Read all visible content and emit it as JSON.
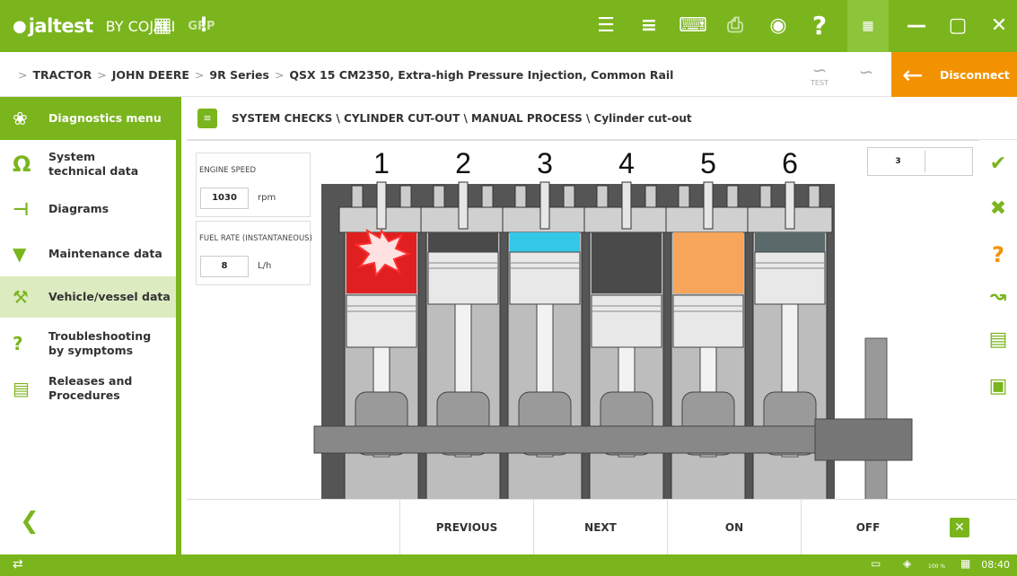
{
  "app": {
    "logo": "jaltest",
    "logo_sub": "BY COJALI",
    "mode": "GRP"
  },
  "breadcrumb": [
    "TRACTOR",
    "JOHN DEERE",
    "9R Series",
    "QSX 15 CM2350, Extra-high Pressure Injection, Common Rail"
  ],
  "breadcrumb_sep": ">",
  "test_label": "TEST",
  "disconnect_label": "Disconnect",
  "sidebar": {
    "items": [
      {
        "label": "Diagnostics menu",
        "icon": "stethoscope-icon"
      },
      {
        "label": "System technical data",
        "icon": "omega-icon"
      },
      {
        "label": "Diagrams",
        "icon": "diagram-icon"
      },
      {
        "label": "Maintenance data",
        "icon": "oil-can-icon"
      },
      {
        "label": "Vehicle/vessel data",
        "icon": "wrench-icon"
      },
      {
        "label": "Troubleshooting by symptoms",
        "icon": "tools-icon"
      },
      {
        "label": "Releases and Procedures",
        "icon": "document-icon"
      }
    ]
  },
  "header": {
    "path": "SYSTEM CHECKS \\ CYLINDER CUT-OUT \\ MANUAL PROCESS \\ Cylinder cut-out"
  },
  "params": {
    "engine_speed": {
      "label": "ENGINE SPEED",
      "value": "1030",
      "unit": "rpm"
    },
    "fuel_rate": {
      "label": "FUEL RATE (INSTANTANEOUS)",
      "value": "8",
      "unit": "L/h"
    }
  },
  "selected_cylinder": "3",
  "cylinders": [
    {
      "label": "1",
      "state": "firing",
      "color": "#e02020"
    },
    {
      "label": "2",
      "state": "dark",
      "color": "#4a4a4a"
    },
    {
      "label": "3",
      "state": "cut-out",
      "color": "#33c7e8"
    },
    {
      "label": "4",
      "state": "dark",
      "color": "#4a4a4a"
    },
    {
      "label": "5",
      "state": "combustion",
      "color": "#f7a55a"
    },
    {
      "label": "6",
      "state": "dark",
      "color": "#5a6a6a"
    }
  ],
  "buttons": {
    "previous": "PREVIOUS",
    "next": "NEXT",
    "on": "ON",
    "off": "OFF"
  },
  "status": {
    "time": "08:40",
    "zoom": "100 %"
  },
  "colors": {
    "brand_green": "#7ab51d",
    "accent_orange": "#f39200"
  }
}
